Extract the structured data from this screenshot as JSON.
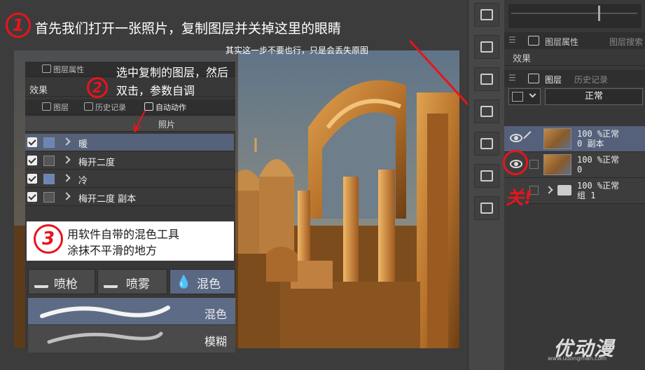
{
  "annotations": {
    "step1_num": "1",
    "step1_text": "首先我们打开一张照片，复制图层并关掉这里的眼睛",
    "step1_note": "其实这一步不要也行，只是会丢失原图",
    "step2_num": "2",
    "step2_line1": "选中复制的图层，然后",
    "step2_line2": "双击，参数自调",
    "step3_num": "3",
    "step3_line1": "用软件自带的混色工具",
    "step3_line2": "涂抹不平滑的地方",
    "x_mark": "关!",
    "colors": {
      "annotation_red": "#e8141c"
    }
  },
  "left_panel": {
    "tab_layer_props": "图层属性",
    "effect_label": "效果",
    "tab_layer": "图层",
    "tab_history": "历史记录",
    "tab_auto_action": "自动动作",
    "group_header": "照片",
    "layers": [
      {
        "name": "暖",
        "selected": true,
        "icon": "blue"
      },
      {
        "name": "梅开二度",
        "selected": false,
        "icon": "gray"
      },
      {
        "name": "冷",
        "selected": false,
        "icon": "blue"
      },
      {
        "name": "梅开二度 副本",
        "selected": false,
        "icon": "gray"
      }
    ],
    "tools": [
      {
        "label": "喷枪",
        "selected": false
      },
      {
        "label": "喷雾",
        "selected": false
      },
      {
        "label": "混色",
        "selected": true
      }
    ],
    "brushes": [
      {
        "label": "混色",
        "selected": true
      },
      {
        "label": "模糊",
        "selected": false
      }
    ]
  },
  "right_panel": {
    "tab_layer_props": "图层属性",
    "tab_layer_search": "图层搜索",
    "effect_label": "效果",
    "tab_layer": "图层",
    "tab_history": "历史记录",
    "blend_mode": "正常",
    "layers": [
      {
        "line1": "100 %正常",
        "line2": "0 副本",
        "selected": true,
        "visible": true
      },
      {
        "line1": "100 %正常",
        "line2": "0",
        "selected": false,
        "visible": true
      },
      {
        "line1": "100 %正常",
        "line2": "组 1",
        "selected": false,
        "visible": false,
        "folder": true
      }
    ]
  },
  "watermark": {
    "logo": "优动漫",
    "url": "www.udongman.com"
  }
}
